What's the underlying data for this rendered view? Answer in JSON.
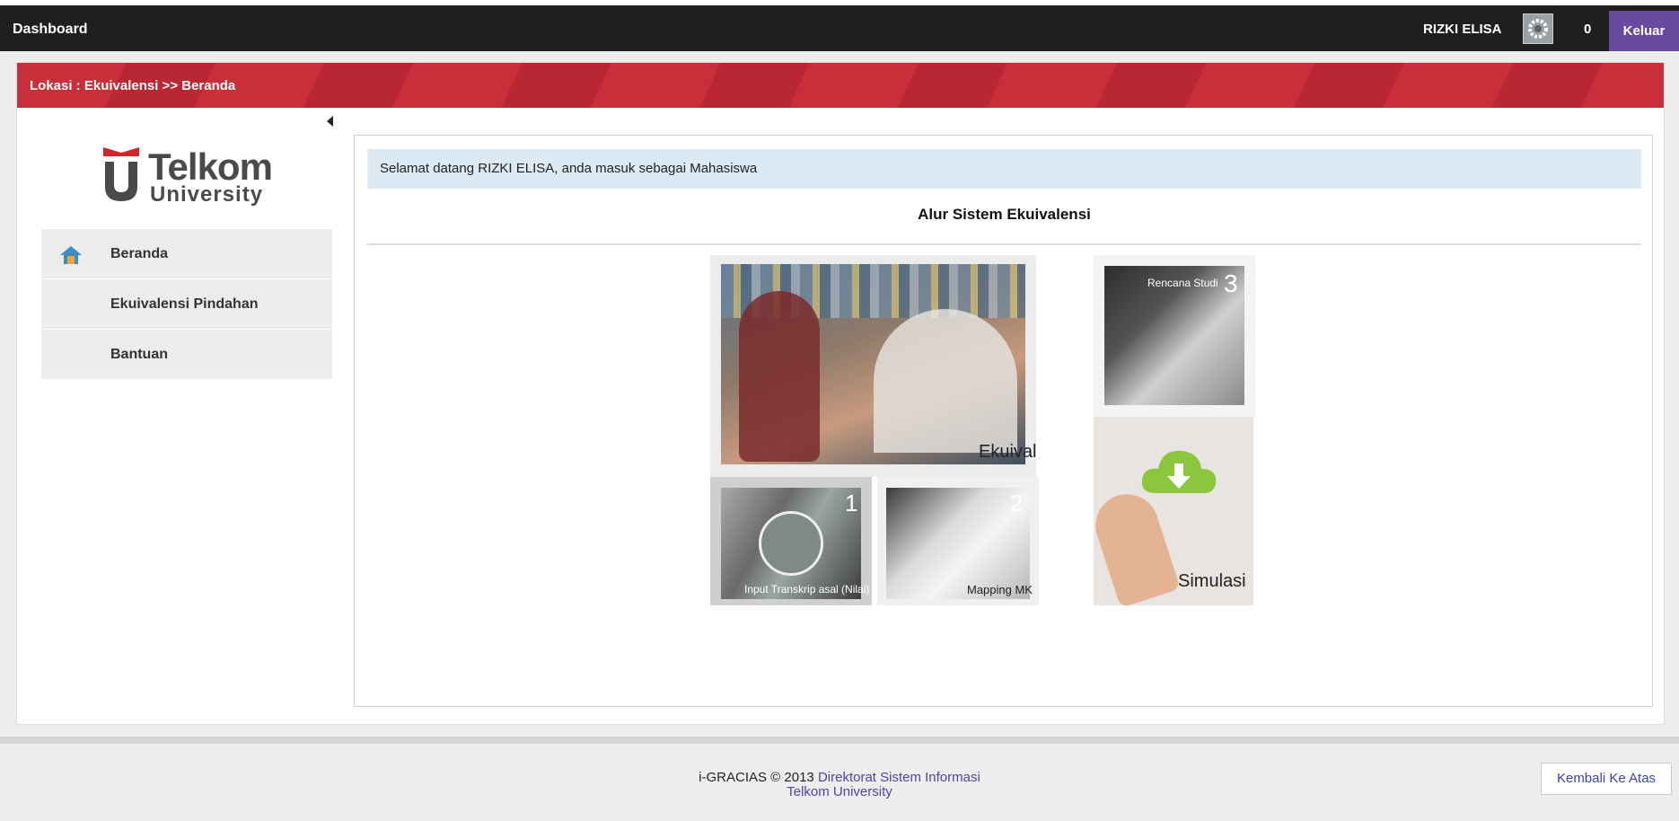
{
  "topbar": {
    "brand": "Dashboard",
    "user": "RIZKI ELISA",
    "notification_count": "0",
    "logout_label": "Keluar"
  },
  "breadcrumb": "Lokasi : Ekuivalensi >> Beranda",
  "logo": {
    "line1": "Telkom",
    "line2": "University"
  },
  "sidebar": {
    "items": [
      {
        "label": "Beranda",
        "icon": "home-icon"
      },
      {
        "label": "Ekuivalensi Pindahan"
      },
      {
        "label": "Bantuan"
      }
    ]
  },
  "main": {
    "welcome": "Selamat datang RIZKI ELISA, anda masuk sebagai Mahasiswa",
    "flow_title": "Alur Sistem Ekuivalensi",
    "tiles": {
      "ekuivalensi": "Ekuivalensi",
      "rencana": "Rencana Studi",
      "rencana_num": "3",
      "input": "Input Transkrip asal (Nilai)",
      "input_num": "1",
      "mapping": "Mapping MK",
      "mapping_num": "2",
      "simulasi": "Simulasi"
    }
  },
  "footer": {
    "prefix": "i-GRACIAS © 2013",
    "org": "Direktorat Sistem Informasi",
    "univ": "Telkom University",
    "back_to_top": "Kembali Ke Atas"
  },
  "colors": {
    "topbar": "#1f1f1f",
    "logout": "#6a4aa0",
    "breadcrumb_bar": "#c92f3a",
    "welcome_bg": "#dde9f3"
  }
}
